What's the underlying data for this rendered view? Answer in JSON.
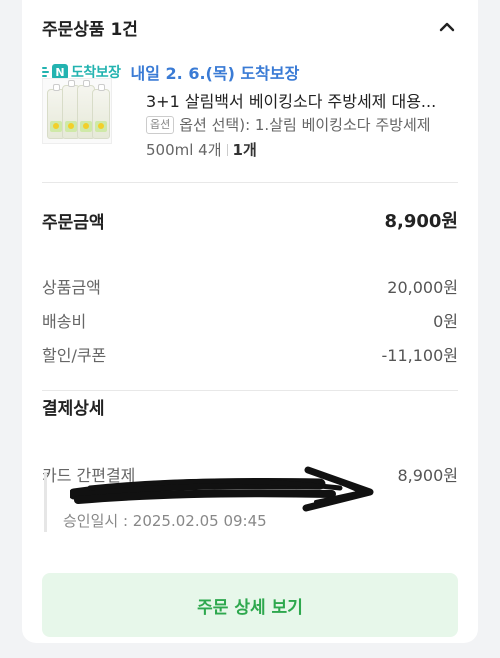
{
  "order_section": {
    "title": "주문상품 1건",
    "collapse_icon": "chevron-up-icon"
  },
  "delivery": {
    "badge_letter": "N",
    "badge_text": "도착보장",
    "date_text": "내일 2. 6.(목) 도착보장",
    "accent_color": "#3a7bd5",
    "badge_color": "#23b3b0"
  },
  "product": {
    "name": "3+1 살림백서 베이킹소다 주방세제 대용...",
    "option_tag": "옵션",
    "option_text": "옵션 선택): 1.살림 베이킹소다 주방세제 500ml 4개",
    "quantity": "1개"
  },
  "amounts": {
    "total_label": "주문금액",
    "total_value": "8,900원",
    "items": [
      {
        "label": "상품금액",
        "value": "20,000원"
      },
      {
        "label": "배송비",
        "value": "0원"
      },
      {
        "label": "할인/쿠폰",
        "value": "-11,100원"
      }
    ]
  },
  "payment": {
    "title": "결제상세",
    "method_label": "카드 간편결제",
    "method_value": "8,900원",
    "approval_text": "승인일시 : 2025.02.05 09:45"
  },
  "actions": {
    "detail_button": "주문 상세 보기",
    "button_bg": "#e7f7ea",
    "button_text_color": "#2ea84e"
  }
}
